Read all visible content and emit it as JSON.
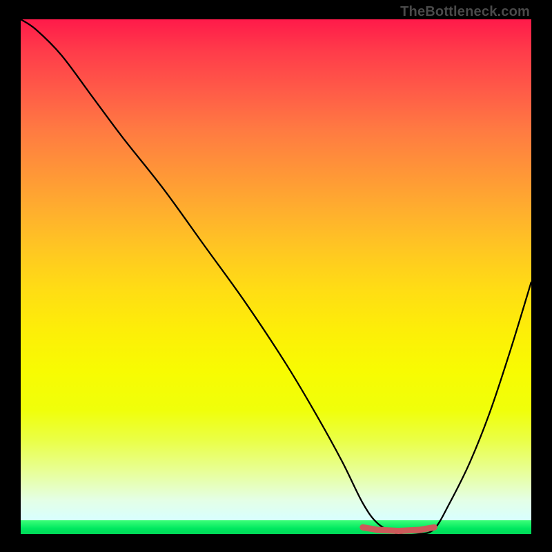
{
  "watermark": "TheBottleneck.com",
  "colors": {
    "background": "#000000",
    "curve": "#000000",
    "marker": "#cc5a5a",
    "gradient_top": "#ff1a4a",
    "gradient_bottom": "#00d858"
  },
  "chart_data": {
    "type": "line",
    "title": "",
    "xlabel": "",
    "ylabel": "",
    "xlim": [
      0,
      100
    ],
    "ylim": [
      0,
      100
    ],
    "note": "Bottleneck-style curve. Vertical axis is relative penalty (top=high/red, bottom=low/green). Curve descends from far-left near top to a flat trough around x≈67–80 at y≈0, then rises toward the right. Flat trough is highlighted with a thick salmon marker. No numeric axis labels are shown in the image; x/y values below are read proportionally.",
    "series": [
      {
        "name": "curve",
        "x": [
          0,
          3,
          8,
          14,
          20,
          28,
          36,
          44,
          52,
          58,
          63,
          67,
          70,
          74,
          78,
          81,
          84,
          88,
          92,
          96,
          100
        ],
        "y": [
          100,
          98,
          93,
          85,
          77,
          67,
          56,
          45,
          33,
          23,
          14,
          6,
          2,
          0,
          0,
          1,
          6,
          14,
          24,
          36,
          49
        ]
      }
    ],
    "highlight": {
      "name": "optimal-range",
      "x": [
        67,
        70,
        74,
        78,
        81
      ],
      "y": [
        1.3,
        0.8,
        0.6,
        0.8,
        1.3
      ]
    }
  }
}
